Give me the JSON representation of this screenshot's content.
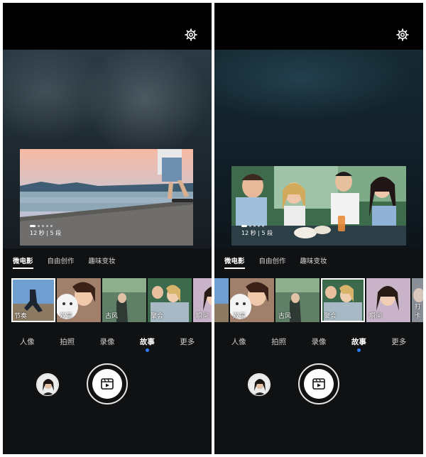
{
  "screens": [
    {
      "mode_tabs": [
        "微电影",
        "自由创作",
        "趣味变妆"
      ],
      "active_mode_tab": 0,
      "preview_caption": "12 秒 | 5 段",
      "filmstrip": [
        {
          "label": "节奏",
          "selected": true
        },
        {
          "label": "双景",
          "selected": false
        },
        {
          "label": "古风",
          "selected": false
        },
        {
          "label": "聚会",
          "selected": false
        },
        {
          "label": "瞬间",
          "selected": false
        }
      ],
      "camera_modes": [
        "人像",
        "拍照",
        "录像",
        "故事",
        "更多"
      ],
      "active_camera_mode": "故事"
    },
    {
      "mode_tabs": [
        "微电影",
        "自由创作",
        "趣味变妆"
      ],
      "active_mode_tab": 0,
      "preview_caption": "12 秒 | 5 段",
      "filmstrip": [
        {
          "label": "",
          "selected": false
        },
        {
          "label": "双景",
          "selected": false
        },
        {
          "label": "古风",
          "selected": false
        },
        {
          "label": "聚会",
          "selected": true
        },
        {
          "label": "瞬间",
          "selected": false
        },
        {
          "label": "打卡",
          "selected": false
        }
      ],
      "camera_modes": [
        "人像",
        "拍照",
        "录像",
        "故事",
        "更多"
      ],
      "active_camera_mode": "故事"
    }
  ],
  "icons": {
    "settings": "gear-icon",
    "shutter": "story-film-icon",
    "gallery": "gallery-thumbnail"
  },
  "colors": {
    "active_indicator": "#2e7cff",
    "background": "#0f1113"
  }
}
